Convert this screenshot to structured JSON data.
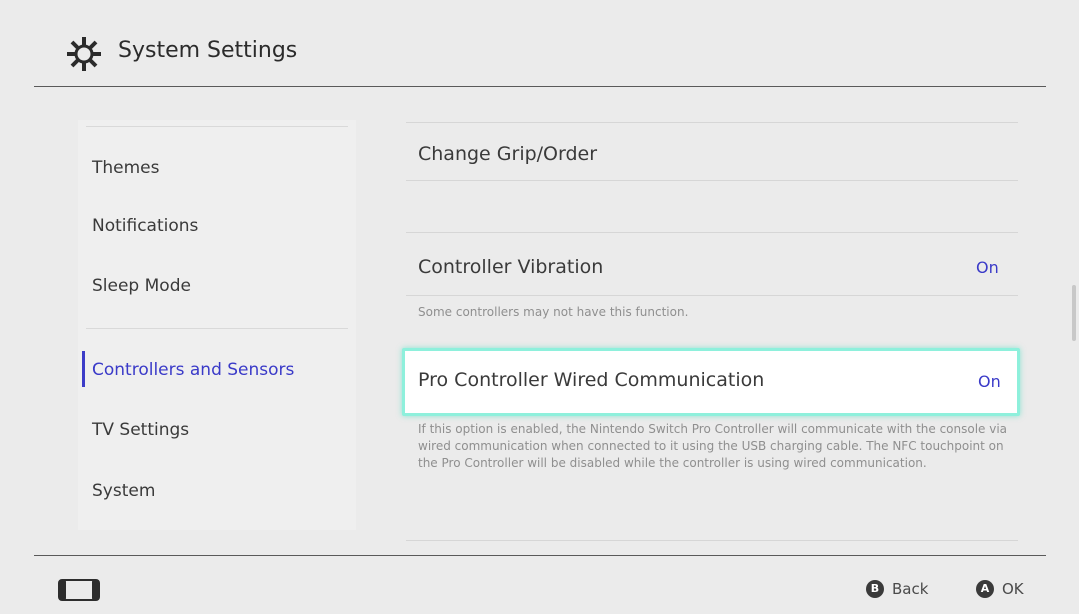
{
  "header": {
    "title": "System Settings",
    "icon": "gear-icon"
  },
  "sidebar": {
    "items": [
      {
        "label": "Themes",
        "active": false
      },
      {
        "label": "Notifications",
        "active": false
      },
      {
        "label": "Sleep Mode",
        "active": false
      },
      {
        "label": "Controllers and Sensors",
        "active": true
      },
      {
        "label": "TV Settings",
        "active": false
      },
      {
        "label": "System",
        "active": false
      }
    ]
  },
  "main": {
    "rows": [
      {
        "label": "Change Grip/Order",
        "value": ""
      },
      {
        "label": "Controller Vibration",
        "value": "On",
        "description": "Some controllers may not have this function."
      },
      {
        "label": "Pro Controller Wired Communication",
        "value": "On",
        "selected": true,
        "description": "If this option is enabled, the Nintendo Switch Pro Controller will communicate with the console via wired communication when connected to it using the USB charging cable. The NFC touchpoint on the Pro Controller will be disabled while the controller is using wired communication."
      }
    ]
  },
  "footer": {
    "back_button": "B",
    "back_label": "Back",
    "ok_button": "A",
    "ok_label": "OK",
    "console_icon": "console-icon"
  },
  "colors": {
    "background": "#ebebeb",
    "accent": "#3a3ac8",
    "selection": "#8ef0dc"
  }
}
